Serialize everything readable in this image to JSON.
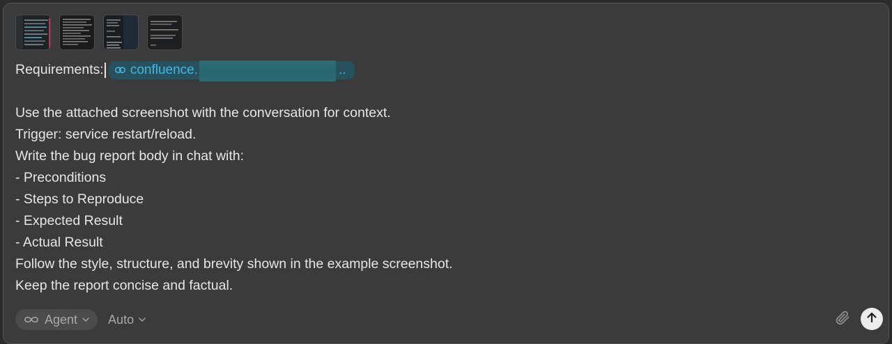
{
  "attachments": [
    {
      "name": "screenshot-1"
    },
    {
      "name": "screenshot-2"
    },
    {
      "name": "screenshot-3"
    },
    {
      "name": "screenshot-4"
    }
  ],
  "editor": {
    "requirements_label": "Requirements:",
    "link_text": "confluence.",
    "link_ellipsis": "..",
    "lines": [
      "Use the attached screenshot with the conversation for context.",
      "Trigger: service restart/reload.",
      "Write the bug report body in chat with:",
      "- Preconditions",
      "- Steps to Reproduce",
      "- Expected Result",
      "- Actual Result",
      "Follow the style, structure, and brevity shown in the example screenshot.",
      "Keep the report concise and factual."
    ]
  },
  "toolbar": {
    "mode_label": "Agent",
    "model_label": "Auto"
  },
  "icons": {
    "mode": "infinity-icon",
    "attach": "paperclip-icon",
    "send": "arrow-up-icon",
    "link": "link-icon"
  },
  "colors": {
    "background": "#3b3b3b",
    "link": "#45b4e0",
    "link_chip": "#27515d",
    "text": "#e6e6e6",
    "muted": "#a9a9a9"
  }
}
